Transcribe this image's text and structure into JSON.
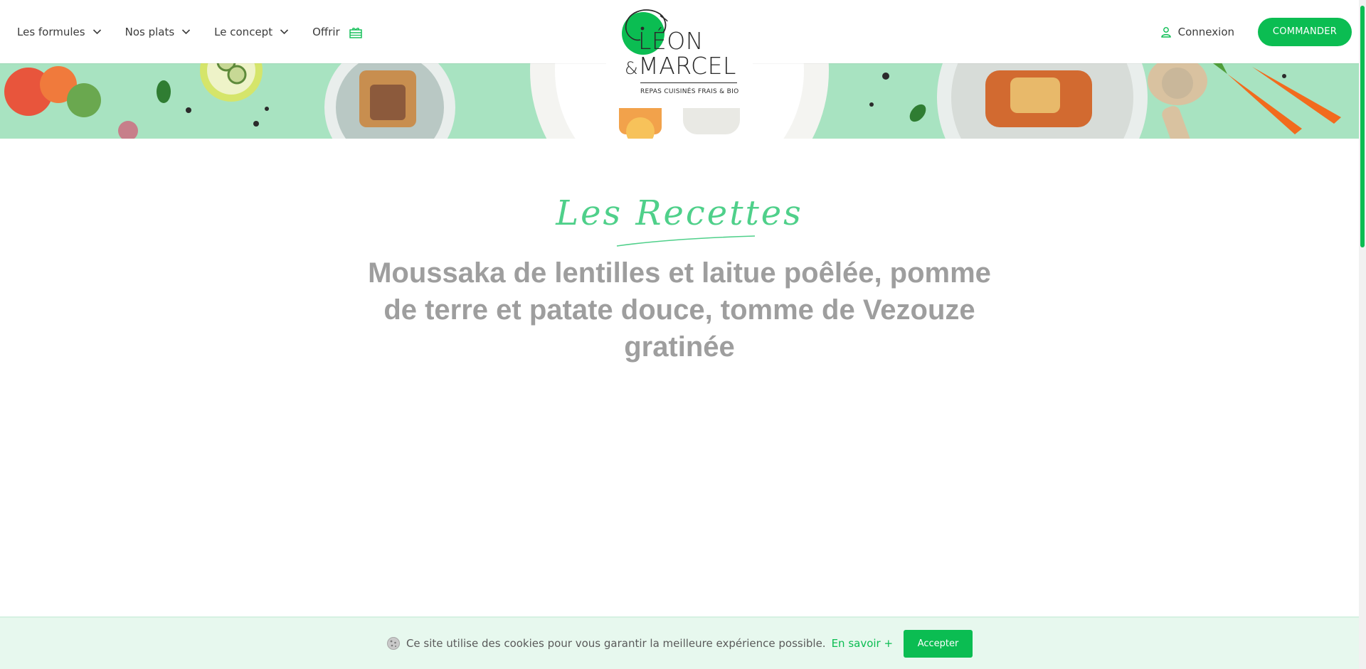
{
  "header": {
    "nav": [
      {
        "label": "Les formules",
        "has_dropdown": true
      },
      {
        "label": "Nos plats",
        "has_dropdown": true
      },
      {
        "label": "Le concept",
        "has_dropdown": true
      },
      {
        "label": "Offrir",
        "icon": "gift-icon"
      }
    ],
    "logo": {
      "line1": "LÉON",
      "amp": "&",
      "line2": "MARCEL",
      "tagline": "REPAS CUISINÉS FRAIS & BIO"
    },
    "login_label": "Connexion",
    "cta_label": "COMMANDER"
  },
  "main": {
    "section_script": "Les Recettes",
    "recipe_title": "Moussaka de lentilles et laitue poêlée, pomme de terre et patate douce, tomme de Vezouze gratinée"
  },
  "cookie_bar": {
    "text": "Ce site utilise des cookies pour vous garantir la meilleure expérience possible.",
    "link_label": "En savoir +",
    "accept_label": "Accepter"
  },
  "colors": {
    "brand_green": "#0bbd52",
    "script_green": "#4fd08a",
    "banner_mint": "#a8e3c1",
    "title_grey": "#9e9e9e",
    "cookie_bg": "#e7f8ee"
  }
}
